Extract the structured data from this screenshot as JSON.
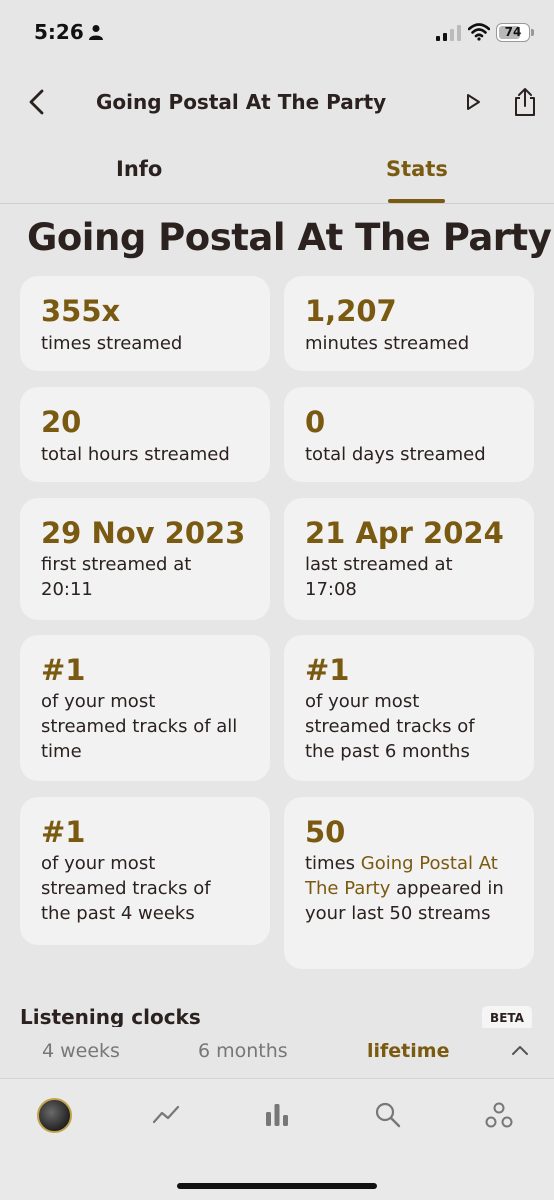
{
  "status_bar": {
    "time": "5:26",
    "battery": "74"
  },
  "nav": {
    "title": "Going Postal At The Party"
  },
  "tabs": {
    "info": "Info",
    "stats": "Stats"
  },
  "page_title": "Going Postal At The Party",
  "cards": [
    {
      "value": "355x",
      "label": "times streamed"
    },
    {
      "value": "1,207",
      "label": "minutes streamed"
    },
    {
      "value": "20",
      "label": "total hours streamed"
    },
    {
      "value": "0",
      "label": "total days streamed"
    },
    {
      "value": "29 Nov 2023",
      "label": "first streamed at 20:11"
    },
    {
      "value": "21 Apr 2024",
      "label": "last streamed at 17:08"
    },
    {
      "value": "#1",
      "label": "of your most streamed tracks of all time"
    },
    {
      "value": "#1",
      "label": "of your most streamed tracks of the past 6 months"
    },
    {
      "value": "#1",
      "label": "of your most streamed tracks of the past 4 weeks"
    },
    {
      "value": "50",
      "label_prefix": "times",
      "label_track": "Going Postal At The Party",
      "label_suffix": "appeared in your last 50 streams"
    }
  ],
  "listening_clocks": {
    "title": "Listening clocks",
    "badge": "BETA"
  },
  "ranges": {
    "weeks": "4 weeks",
    "months": "6 months",
    "lifetime": "lifetime",
    "selected": "lifetime"
  },
  "tab_bar": [
    "avatar",
    "trend-icon",
    "chart-icon",
    "search-icon",
    "friends-icon"
  ],
  "colors": {
    "accent": "#7a5a10",
    "background": "#e6e6e6",
    "card": "#f2f2f2",
    "text": "#2b2220"
  }
}
